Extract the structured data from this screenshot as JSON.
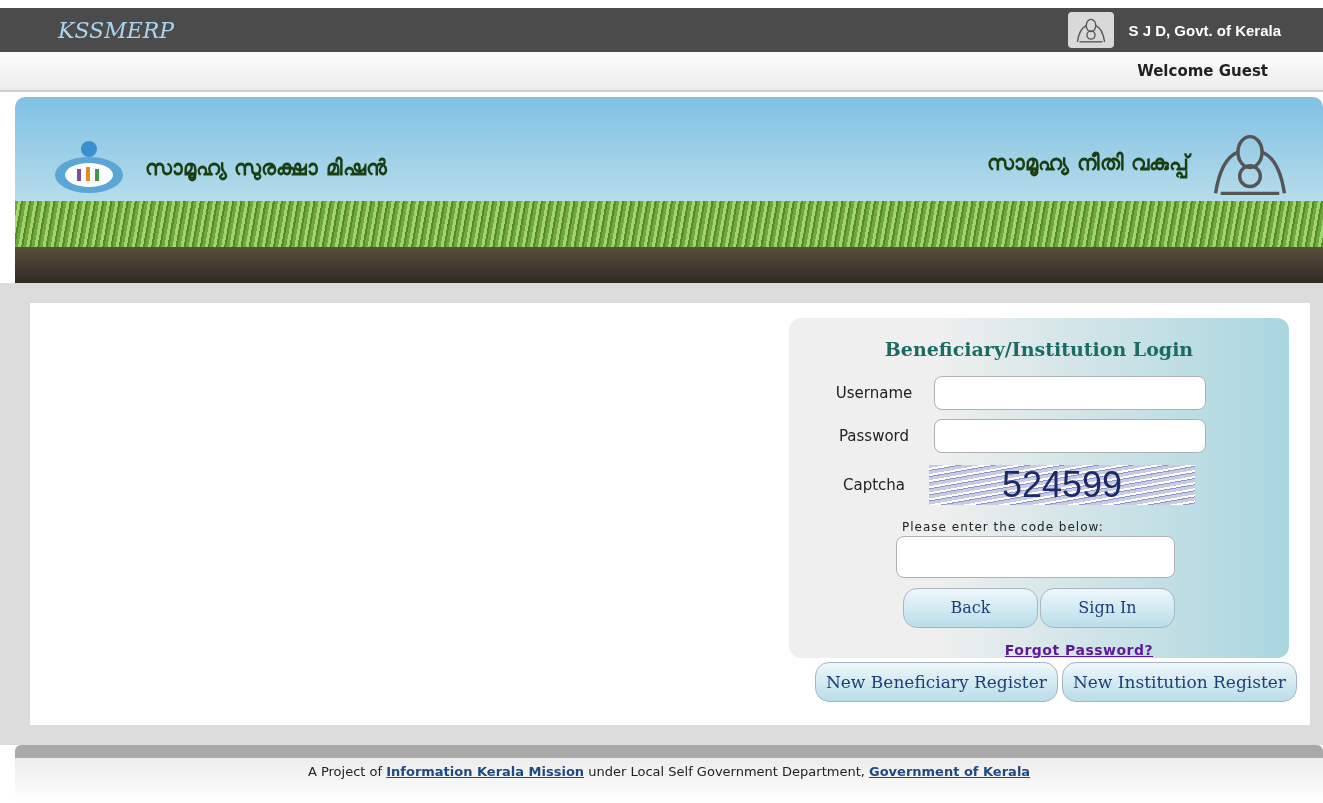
{
  "header": {
    "logo": "KSSMERP",
    "department": "S J D, Govt. of Kerala"
  },
  "subheader": {
    "welcome": "Welcome Guest"
  },
  "banner": {
    "left_title": "സാമൂഹ്യ സുരക്ഷാ മിഷൻ",
    "right_title": "സാമൂഹ്യ നീതി വകുപ്പ്"
  },
  "login": {
    "title": "Beneficiary/Institution Login",
    "fields": [
      {
        "label": "Username"
      },
      {
        "label": "Password"
      }
    ],
    "captcha": {
      "label": "Captcha",
      "code": "524599",
      "hint": "Please enter the code below:"
    },
    "buttons": [
      "Back",
      "Sign In"
    ],
    "forgot_link": "Forgot Password?",
    "register_buttons": [
      "New Beneficiary Register",
      "New Institution Register"
    ]
  },
  "footer": {
    "prefix": "A Project of",
    "link_1": "Information Kerala Mission",
    "middle": "under Local Self Government Department,",
    "link_2": "Government of Kerala"
  }
}
